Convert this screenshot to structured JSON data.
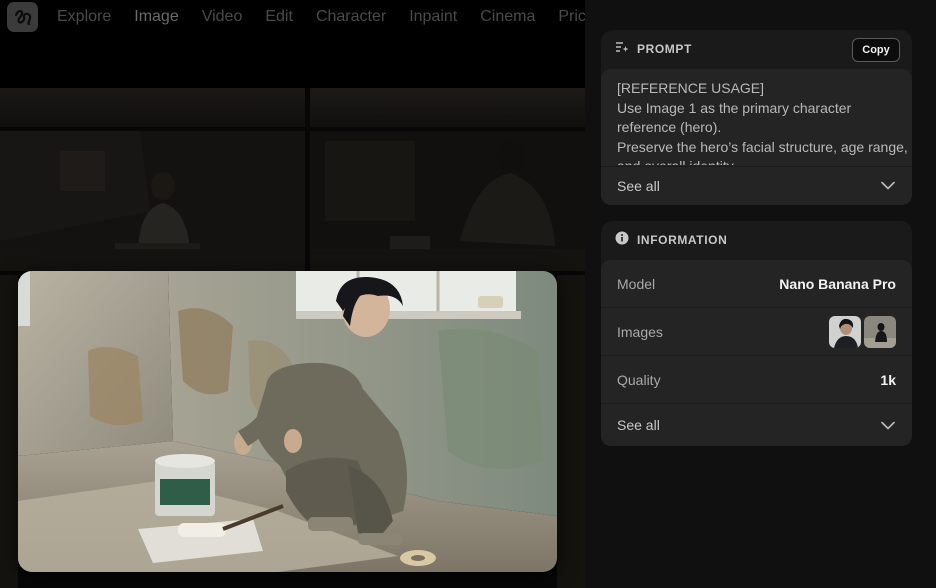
{
  "nav": {
    "items": [
      "Explore",
      "Image",
      "Video",
      "Edit",
      "Character",
      "Inpaint",
      "Cinema",
      "Pricing"
    ],
    "active": "Image"
  },
  "prompt": {
    "title": "PROMPT",
    "copy_label": "Copy",
    "lines": [
      "[REFERENCE USAGE]",
      "Use Image 1 as the primary character",
      "reference (hero).",
      "Preserve the hero’s facial structure, age range,",
      "and overall identity"
    ],
    "see_all": "See all"
  },
  "information": {
    "title": "INFORMATION",
    "rows": {
      "model": {
        "label": "Model",
        "value": "Nano Banana Pro"
      },
      "images": {
        "label": "Images"
      },
      "quality": {
        "label": "Quality",
        "value": "1k"
      }
    },
    "see_all": "See all"
  },
  "icons": {
    "logo": "brand-logo-icon",
    "prompt": "prompt-sparkle-icon",
    "info": "info-circle-icon",
    "chevron": "chevron-down-icon"
  },
  "colors": {
    "panel_bg": "#101010",
    "card_bg": "#1a1a1a",
    "inner_bg": "#242424",
    "text_muted": "#a9a9a9"
  }
}
